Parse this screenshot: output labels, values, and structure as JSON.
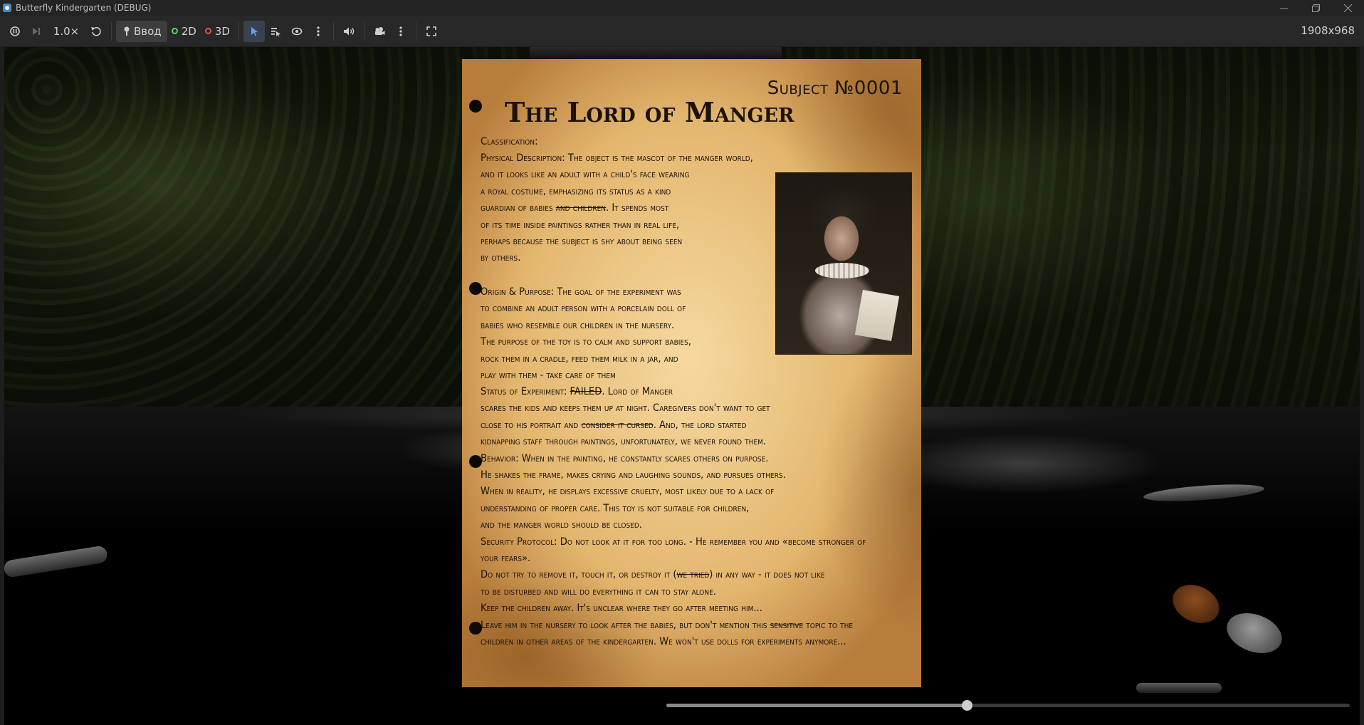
{
  "window": {
    "title": "Butterfly Kindergarten (DEBUG)",
    "controls": [
      "minimize",
      "restore",
      "close"
    ]
  },
  "toolbar": {
    "speed": "1.0×",
    "input_label": "Ввод",
    "mode_2d": "2D",
    "mode_3d": "3D",
    "resolution": "1908x968",
    "colors": {
      "mode_2d": "#5bd46b",
      "mode_3d": "#e05555",
      "accent": "#478cbf"
    }
  },
  "document": {
    "subject": "Subject №0001",
    "title": "The Lord of Manger",
    "classification": "Classification:",
    "physical": [
      {
        "text": "Physical Description: The object is the mascot of the manger world,"
      },
      {
        "text": "and it looks like an adult with a child's face wearing"
      },
      {
        "text": "a royal costume, emphasizing its status as a kind"
      },
      {
        "pre": "guardian of babies ",
        "strike": "and children",
        "post": ". It spends most"
      },
      {
        "text": "of its time inside paintings rather than in real life,"
      },
      {
        "text": "perhaps because the subject is shy about being seen"
      },
      {
        "text": "by others."
      }
    ],
    "origin": [
      {
        "text": "Origin & Purpose: The goal of the experiment was"
      },
      {
        "text": "to combine an adult person with a porcelain doll of"
      },
      {
        "text": "babies who resemble our children in the nursery."
      },
      {
        "text": "The purpose of the toy is to calm and support babies,"
      },
      {
        "text": "rock them in a cradle, feed them milk in a jar, and"
      },
      {
        "text": "play with them - take care of them"
      }
    ],
    "status": [
      {
        "pre": "Status of Experiment: ",
        "strike": "FAILED",
        "post": ". Lord of Manger"
      },
      {
        "text": "scares the kids and keeps them up at night. Caregivers don't want to get"
      },
      {
        "pre": "close to his portrait and ",
        "strike": "consider it cursed",
        "post": ". And, the lord started"
      },
      {
        "text": "kidnapping staff through paintings, unfortunately, we never found them."
      },
      {
        "text": "Behavior: When in the painting, he constantly scares others on purpose."
      },
      {
        "text": "He shakes the frame, makes crying and laughing sounds, and pursues others."
      },
      {
        "text": "When in reality, he displays excessive cruelty, most likely due to a lack of"
      },
      {
        "text": "understanding of proper care. This toy is not suitable for children,"
      },
      {
        "text": "and the manger world should be closed."
      },
      {
        "text": "Security Protocol: Do not look at it for too long. - He remember you and «become stronger of"
      },
      {
        "text": "your fears»."
      },
      {
        "pre": "Do not try to remove it, touch it, or destroy it (",
        "strike": "we tried",
        "post": ") in any way - it does not like"
      },
      {
        "text": "to be disturbed and will do everything it can to stay alone."
      },
      {
        "text": "Keep the children away. It's unclear where they go after meeting him..."
      },
      {
        "pre": "Leave him in the nursery to look after the babies, but don't mention this ",
        "strike": "sensitive",
        "post": " topic to the"
      },
      {
        "text": "children in other areas of the kindergarten. We won't use dolls for experiments anymore..."
      }
    ]
  },
  "slider": {
    "value": 0.44
  }
}
